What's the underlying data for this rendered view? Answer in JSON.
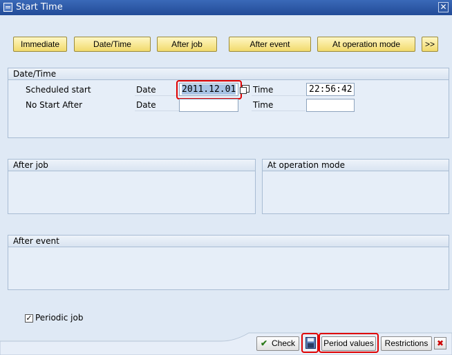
{
  "window": {
    "title": "Start Time",
    "close_symbol": "✕"
  },
  "toolbar": {
    "immediate": "Immediate",
    "date_time": "Date/Time",
    "after_job": "After job",
    "after_event": "After event",
    "at_operation_mode": "At operation mode",
    "more": ">>"
  },
  "date_time_group": {
    "title": "Date/Time",
    "scheduled_start": {
      "label": "Scheduled start",
      "date_label": "Date",
      "date_value": "2011.12.01",
      "time_label": "Time",
      "time_value": "22:56:42"
    },
    "no_start_after": {
      "label": "No Start After",
      "date_label": "Date",
      "date_value": "",
      "time_label": "Time",
      "time_value": ""
    }
  },
  "after_job_group": {
    "title": "After job"
  },
  "at_operation_mode_group": {
    "title": "At operation mode"
  },
  "after_event_group": {
    "title": "After event"
  },
  "periodic_job": {
    "label": "Periodic job",
    "checked": true,
    "check_symbol": "✓"
  },
  "footer": {
    "check": "Check",
    "check_symbol": "✔",
    "period_values": "Period values",
    "restrictions": "Restrictions",
    "cancel_symbol": "✖"
  },
  "colors": {
    "highlight": "#e00000",
    "button_yellow": "#f1da6c",
    "title_bar": "#2b56a2"
  }
}
